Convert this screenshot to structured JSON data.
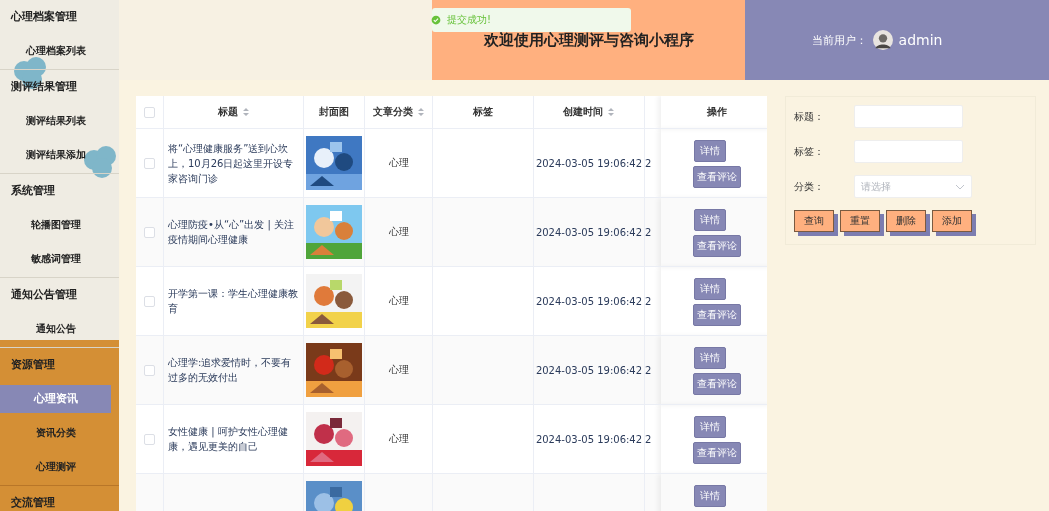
{
  "sidebar": {
    "groups": [
      {
        "label": "心理档案管理",
        "items": [
          {
            "label": "心理档案列表",
            "selected": false
          }
        ]
      },
      {
        "label": "测评结果管理",
        "items": [
          {
            "label": "测评结果列表",
            "selected": false
          },
          {
            "label": "测评结果添加",
            "selected": false
          }
        ]
      },
      {
        "label": "系统管理",
        "items": [
          {
            "label": "轮播图管理",
            "selected": false
          },
          {
            "label": "敏感词管理",
            "selected": false
          }
        ]
      },
      {
        "label": "通知公告管理",
        "items": [
          {
            "label": "通知公告",
            "selected": false
          }
        ]
      },
      {
        "label": "资源管理",
        "items": [
          {
            "label": "心理资讯",
            "selected": true
          },
          {
            "label": "资讯分类",
            "selected": false
          },
          {
            "label": "心理测评",
            "selected": false
          }
        ]
      },
      {
        "label": "交流管理"
      }
    ]
  },
  "header": {
    "title": "欢迎使用心理测评与咨询小程序",
    "user_label": "当前用户：",
    "username": "admin"
  },
  "toast": {
    "message": "提交成功!"
  },
  "table": {
    "select_all": {
      "checked": false
    },
    "columns": [
      {
        "label": "标题",
        "sortable": true
      },
      {
        "label": "封面图",
        "sortable": false
      },
      {
        "label": "文章分类",
        "sortable": true
      },
      {
        "label": "标签",
        "sortable": false
      },
      {
        "label": "创建时间",
        "sortable": true
      },
      {
        "label": "操作",
        "sortable": false
      }
    ],
    "rows": [
      {
        "checked": false,
        "title": "将“心理健康服务”送到心坎上，10月26日起这里开设专家咨询门诊",
        "category": "心理",
        "created": "2024-03-05 19:06:42",
        "column_7": "2",
        "actions": [
          "详情",
          "查看评论"
        ]
      },
      {
        "checked": false,
        "title": "心理防疫•从“心”出发 | 关注疫情期间心理健康",
        "category": "心理",
        "created": "2024-03-05 19:06:42",
        "column_7": "2",
        "actions": [
          "详情",
          "查看评论"
        ]
      },
      {
        "checked": false,
        "title": "开学第一课：学生心理健康教育",
        "category": "心理",
        "created": "2024-03-05 19:06:42",
        "column_7": "2",
        "actions": [
          "详情",
          "查看评论"
        ]
      },
      {
        "checked": false,
        "title": "心理学:追求爱情时，不要有过多的无效付出",
        "category": "心理",
        "created": "2024-03-05 19:06:42",
        "column_7": "2",
        "actions": [
          "详情",
          "查看评论"
        ]
      },
      {
        "checked": false,
        "title": "女性健康 | 呵护女性心理健康，遇见更美的自己",
        "category": "心理",
        "created": "2024-03-05 19:06:42",
        "column_7": "2",
        "actions": [
          "详情",
          "查看评论"
        ]
      },
      {
        "actions": [
          "详情"
        ]
      }
    ]
  },
  "search": {
    "fields": [
      {
        "label": "标题：",
        "kind": "text"
      },
      {
        "label": "标签：",
        "kind": "text"
      },
      {
        "label": "分类：",
        "kind": "select",
        "placeholder": "请选择"
      }
    ],
    "buttons": [
      "查询",
      "重置",
      "删除",
      "添加"
    ]
  }
}
